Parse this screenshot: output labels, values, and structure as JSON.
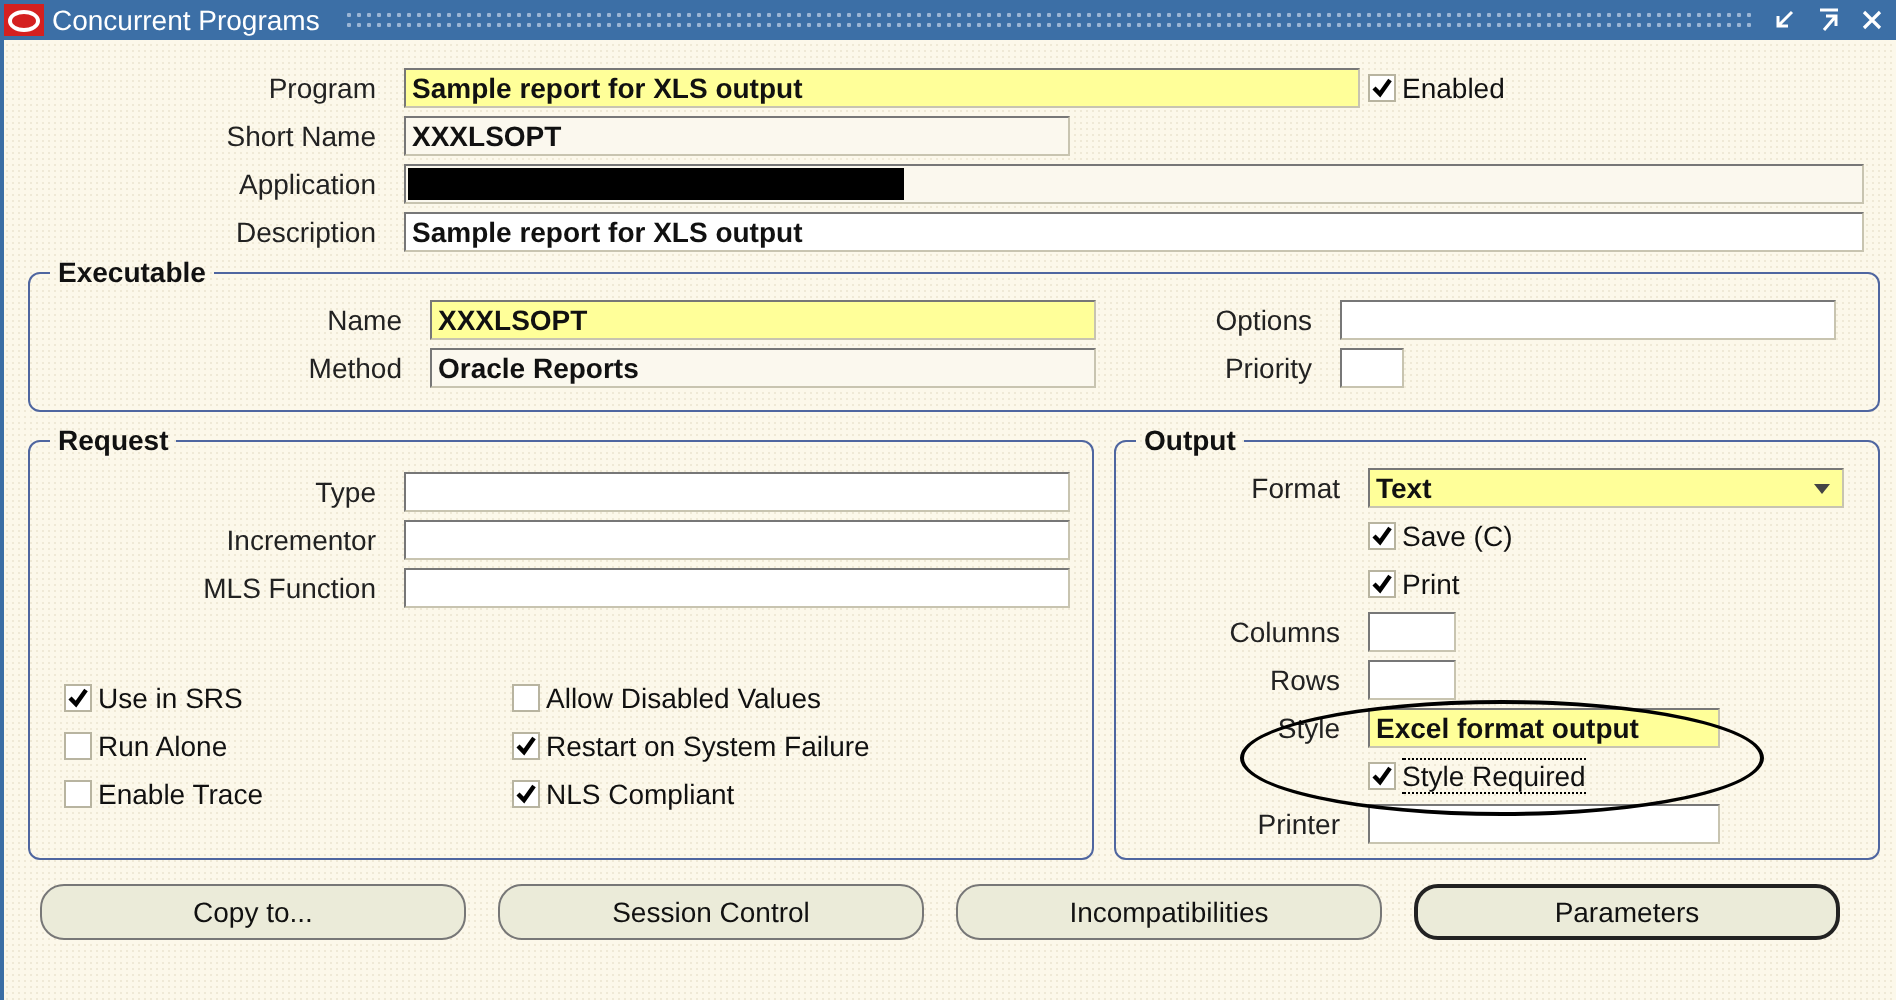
{
  "window": {
    "title": "Concurrent Programs"
  },
  "header": {
    "fields": [
      {
        "label": "Program",
        "value": "Sample report for XLS output",
        "required": true,
        "readonly": false
      },
      {
        "label": "Short Name",
        "value": "XXXLSOPT",
        "required": false,
        "readonly": true
      },
      {
        "label": "Application",
        "redacted": true,
        "required": false,
        "readonly": true
      },
      {
        "label": "Description",
        "value": "Sample report for XLS output",
        "required": false,
        "readonly": false
      }
    ],
    "enabled": {
      "label": "Enabled",
      "checked": true
    }
  },
  "executable": {
    "title": "Executable",
    "left": [
      {
        "label": "Name",
        "value": "XXXLSOPT",
        "required": true,
        "readonly": false
      },
      {
        "label": "Method",
        "value": "Oracle Reports",
        "required": false,
        "readonly": true
      }
    ],
    "right": [
      {
        "label": "Options",
        "required": false,
        "readonly": false
      },
      {
        "label": "Priority",
        "required": false,
        "readonly": false
      }
    ]
  },
  "request": {
    "title": "Request",
    "fields": [
      {
        "label": "Type",
        "required": false,
        "readonly": false
      },
      {
        "label": "Incrementor",
        "required": false,
        "readonly": false
      },
      {
        "label": "MLS Function",
        "required": false,
        "readonly": false
      }
    ],
    "checkboxes": [
      {
        "label": "Use in SRS",
        "checked": true
      },
      {
        "label": "Allow Disabled Values",
        "checked": false
      },
      {
        "label": "Run Alone",
        "checked": false
      },
      {
        "label": "Restart on System Failure",
        "checked": true
      },
      {
        "label": "Enable Trace",
        "checked": false
      },
      {
        "label": "NLS Compliant",
        "checked": true
      }
    ]
  },
  "output": {
    "title": "Output",
    "rows": [
      {
        "kind": "dropdown",
        "label": "Format",
        "value": "Text",
        "required": true
      },
      {
        "kind": "checkbox",
        "label": "Save (C)",
        "checked": true
      },
      {
        "kind": "checkbox",
        "label": "Print",
        "checked": true
      },
      {
        "kind": "field",
        "label": "Columns",
        "required": false
      },
      {
        "kind": "field",
        "label": "Rows",
        "required": false
      },
      {
        "kind": "field",
        "label": "Style",
        "value": "Excel format output",
        "required": true,
        "circled": true
      },
      {
        "kind": "checkbox",
        "label": "Style Required",
        "checked": true,
        "dotted": true
      },
      {
        "kind": "field",
        "label": "Printer",
        "required": false
      }
    ]
  },
  "buttons": [
    {
      "label": "Copy to...",
      "default": false
    },
    {
      "label": "Session Control",
      "default": false
    },
    {
      "label": "Incompatibilities",
      "default": false
    },
    {
      "label": "Parameters",
      "default": true
    }
  ]
}
